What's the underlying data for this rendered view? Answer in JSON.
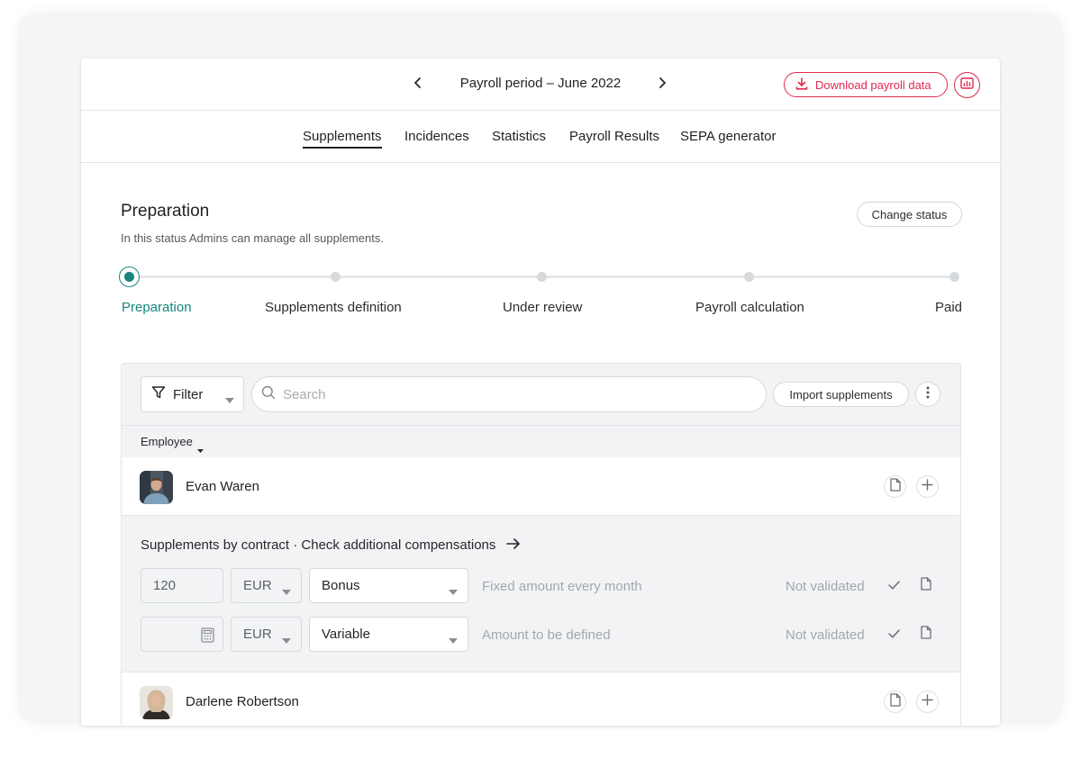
{
  "header": {
    "period_title": "Payroll period – June 2022",
    "download_label": "Download payroll data"
  },
  "tabs": [
    {
      "label": "Supplements",
      "active": true
    },
    {
      "label": "Incidences",
      "active": false
    },
    {
      "label": "Statistics",
      "active": false
    },
    {
      "label": "Payroll Results",
      "active": false
    },
    {
      "label": "SEPA generator",
      "active": false
    }
  ],
  "status": {
    "title": "Preparation",
    "description": "In this status Admins can manage all supplements.",
    "change_label": "Change status"
  },
  "stepper": {
    "active_index": 0,
    "steps": [
      "Preparation",
      "Supplements definition",
      "Under review",
      "Payroll calculation",
      "Paid"
    ]
  },
  "toolbar": {
    "filter_label": "Filter",
    "search_placeholder": "Search",
    "import_label": "Import supplements"
  },
  "table": {
    "column_header": "Employee",
    "rows": [
      {
        "name": "Evan Waren",
        "expanded": true
      },
      {
        "name": "Darlene Robertson",
        "expanded": false
      }
    ]
  },
  "supplements": {
    "title": "Supplements by contract · Check additional compensations",
    "items": [
      {
        "amount": "120",
        "currency": "EUR",
        "type": "Bonus",
        "note": "Fixed amount every month",
        "status": "Not validated"
      },
      {
        "amount": "",
        "currency": "EUR",
        "type": "Variable",
        "note": "Amount to be defined",
        "status": "Not validated"
      }
    ]
  },
  "icons": {
    "prev": "chevron-left-icon",
    "next": "chevron-right-icon",
    "download": "download-icon",
    "chart": "chart-icon",
    "filter": "filter-icon",
    "search": "search-icon",
    "more": "kebab-icon",
    "document": "document-icon",
    "add": "plus-icon",
    "check": "check-icon",
    "calculator": "calculator-icon",
    "arrow": "arrow-right-icon"
  },
  "colors": {
    "accent_red": "#e0294f",
    "accent_teal": "#17877d"
  }
}
